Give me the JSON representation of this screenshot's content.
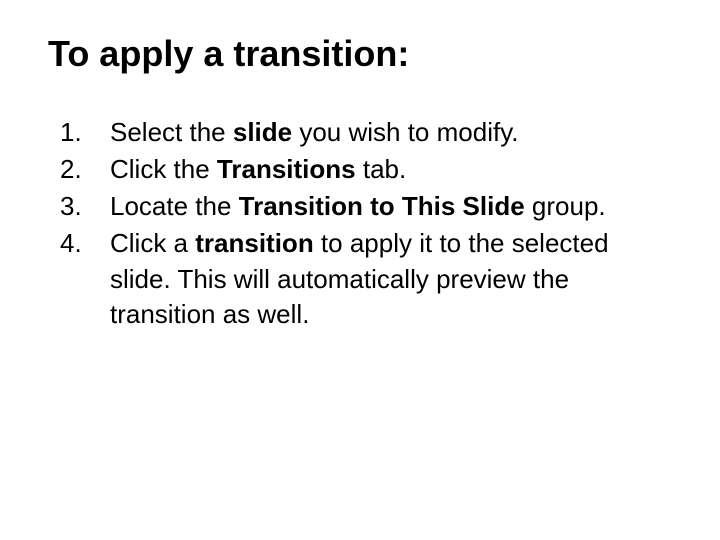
{
  "title": "To apply a transition:",
  "steps": {
    "s1": {
      "p1": "Select the ",
      "b1": "slide",
      "p2": " you wish to modify."
    },
    "s2": {
      "p1": "Click the ",
      "b1": "Transitions",
      "p2": " tab."
    },
    "s3": {
      "p1": "Locate the ",
      "b1": "Transition to This Slide",
      "p2": " group."
    },
    "s4": {
      "p1": "Click a ",
      "b1": "transition",
      "p2": " to apply it to the selected slide. This will automatically preview the transition as well."
    }
  }
}
